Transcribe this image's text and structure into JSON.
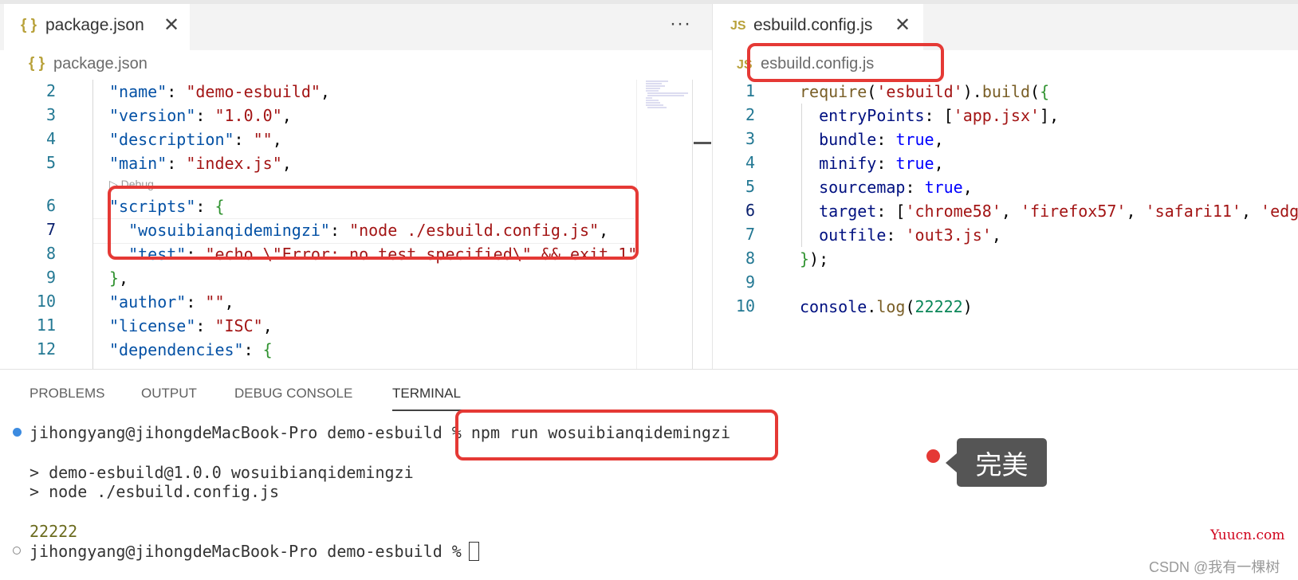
{
  "left_editor": {
    "tab": {
      "icon": "{ }",
      "label": "package.json",
      "close": "✕"
    },
    "more": "···",
    "breadcrumb": {
      "icon": "{ }",
      "label": "package.json"
    },
    "codelens": "▷ Debug",
    "lines": [
      {
        "n": "2",
        "tokens": [
          [
            "k-key",
            "\"name\""
          ],
          [
            "k-punc",
            ": "
          ],
          [
            "k-str",
            "\"demo-esbuild\""
          ],
          [
            "k-punc",
            ","
          ]
        ]
      },
      {
        "n": "3",
        "tokens": [
          [
            "k-key",
            "\"version\""
          ],
          [
            "k-punc",
            ": "
          ],
          [
            "k-str",
            "\"1.0.0\""
          ],
          [
            "k-punc",
            ","
          ]
        ]
      },
      {
        "n": "4",
        "tokens": [
          [
            "k-key",
            "\"description\""
          ],
          [
            "k-punc",
            ": "
          ],
          [
            "k-str",
            "\"\""
          ],
          [
            "k-punc",
            ","
          ]
        ]
      },
      {
        "n": "5",
        "tokens": [
          [
            "k-key",
            "\"main\""
          ],
          [
            "k-punc",
            ": "
          ],
          [
            "k-str",
            "\"index.js\""
          ],
          [
            "k-punc",
            ","
          ]
        ]
      },
      {
        "n": "6",
        "tokens": [
          [
            "k-key",
            "\"scripts\""
          ],
          [
            "k-punc",
            ": "
          ],
          [
            "k-brace",
            "{"
          ]
        ]
      },
      {
        "n": "7",
        "tokens": [
          [
            "k-punc",
            "  "
          ],
          [
            "k-key",
            "\"wosuibianqidemingzi\""
          ],
          [
            "k-punc",
            ": "
          ],
          [
            "k-str",
            "\"node ./esbuild.config.js\""
          ],
          [
            "k-punc",
            ","
          ]
        ]
      },
      {
        "n": "8",
        "tokens": [
          [
            "k-punc",
            "  "
          ],
          [
            "k-key",
            "\"test\""
          ],
          [
            "k-punc",
            ": "
          ],
          [
            "k-str",
            "\"echo \\\"Error: no test specified\\\" && exit 1\""
          ]
        ]
      },
      {
        "n": "9",
        "tokens": [
          [
            "k-brace",
            "}"
          ],
          [
            "k-punc",
            ","
          ]
        ]
      },
      {
        "n": "10",
        "tokens": [
          [
            "k-key",
            "\"author\""
          ],
          [
            "k-punc",
            ": "
          ],
          [
            "k-str",
            "\"\""
          ],
          [
            "k-punc",
            ","
          ]
        ]
      },
      {
        "n": "11",
        "tokens": [
          [
            "k-key",
            "\"license\""
          ],
          [
            "k-punc",
            ": "
          ],
          [
            "k-str",
            "\"ISC\""
          ],
          [
            "k-punc",
            ","
          ]
        ]
      },
      {
        "n": "12",
        "tokens": [
          [
            "k-key",
            "\"dependencies\""
          ],
          [
            "k-punc",
            ": "
          ],
          [
            "k-brace",
            "{"
          ]
        ]
      }
    ]
  },
  "right_editor": {
    "tab": {
      "icon": "JS",
      "label": "esbuild.config.js",
      "close": "✕"
    },
    "breadcrumb": {
      "icon": "JS",
      "label": "esbuild.config.js"
    },
    "lines": [
      {
        "n": "1",
        "tokens": [
          [
            "k-fn",
            "require"
          ],
          [
            "k-punc",
            "("
          ],
          [
            "k-str",
            "'esbuild'"
          ],
          [
            "k-punc",
            ")."
          ],
          [
            "k-fn",
            "build"
          ],
          [
            "k-punc",
            "("
          ],
          [
            "k-brace",
            "{"
          ]
        ]
      },
      {
        "n": "2",
        "tokens": [
          [
            "k-punc",
            "  "
          ],
          [
            "k-prop",
            "entryPoints"
          ],
          [
            "k-punc",
            ": ["
          ],
          [
            "k-str",
            "'app.jsx'"
          ],
          [
            "k-punc",
            "],"
          ]
        ]
      },
      {
        "n": "3",
        "tokens": [
          [
            "k-punc",
            "  "
          ],
          [
            "k-prop",
            "bundle"
          ],
          [
            "k-punc",
            ": "
          ],
          [
            "k-bool",
            "true"
          ],
          [
            "k-punc",
            ","
          ]
        ]
      },
      {
        "n": "4",
        "tokens": [
          [
            "k-punc",
            "  "
          ],
          [
            "k-prop",
            "minify"
          ],
          [
            "k-punc",
            ": "
          ],
          [
            "k-bool",
            "true"
          ],
          [
            "k-punc",
            ","
          ]
        ]
      },
      {
        "n": "5",
        "tokens": [
          [
            "k-punc",
            "  "
          ],
          [
            "k-prop",
            "sourcemap"
          ],
          [
            "k-punc",
            ": "
          ],
          [
            "k-bool",
            "true"
          ],
          [
            "k-punc",
            ","
          ]
        ]
      },
      {
        "n": "6",
        "tokens": [
          [
            "k-punc",
            "  "
          ],
          [
            "k-prop",
            "target"
          ],
          [
            "k-punc",
            ": ["
          ],
          [
            "k-str",
            "'chrome58'"
          ],
          [
            "k-punc",
            ", "
          ],
          [
            "k-str",
            "'firefox57'"
          ],
          [
            "k-punc",
            ", "
          ],
          [
            "k-str",
            "'safari11'"
          ],
          [
            "k-punc",
            ", "
          ],
          [
            "k-str",
            "'edg"
          ]
        ]
      },
      {
        "n": "7",
        "tokens": [
          [
            "k-punc",
            "  "
          ],
          [
            "k-prop",
            "outfile"
          ],
          [
            "k-punc",
            ": "
          ],
          [
            "k-str",
            "'out3.js'"
          ],
          [
            "k-punc",
            ","
          ]
        ]
      },
      {
        "n": "8",
        "tokens": [
          [
            "k-brace",
            "}"
          ],
          [
            "k-punc",
            ");"
          ]
        ]
      },
      {
        "n": "9",
        "tokens": []
      },
      {
        "n": "10",
        "tokens": [
          [
            "k-prop",
            "console"
          ],
          [
            "k-punc",
            "."
          ],
          [
            "k-fn",
            "log"
          ],
          [
            "k-punc",
            "("
          ],
          [
            "k-num",
            "22222"
          ],
          [
            "k-punc",
            ")"
          ]
        ]
      }
    ]
  },
  "panel": {
    "tabs": [
      "PROBLEMS",
      "OUTPUT",
      "DEBUG CONSOLE",
      "TERMINAL"
    ],
    "active_tab": "TERMINAL",
    "terminal": {
      "prompt1": "jihongyang@jihongdeMacBook-Pro demo-esbuild % ",
      "cmd1": "npm run wosuibianqidemingzi",
      "out1": "> demo-esbuild@1.0.0 wosuibianqidemingzi",
      "out2": "> node ./esbuild.config.js",
      "out3": "22222",
      "prompt2": "jihongyang@jihongdeMacBook-Pro demo-esbuild % "
    }
  },
  "annotation": {
    "tooltip": "完美"
  },
  "watermark": {
    "site": "Yuucn.com",
    "credit": "CSDN @我有一棵树"
  }
}
